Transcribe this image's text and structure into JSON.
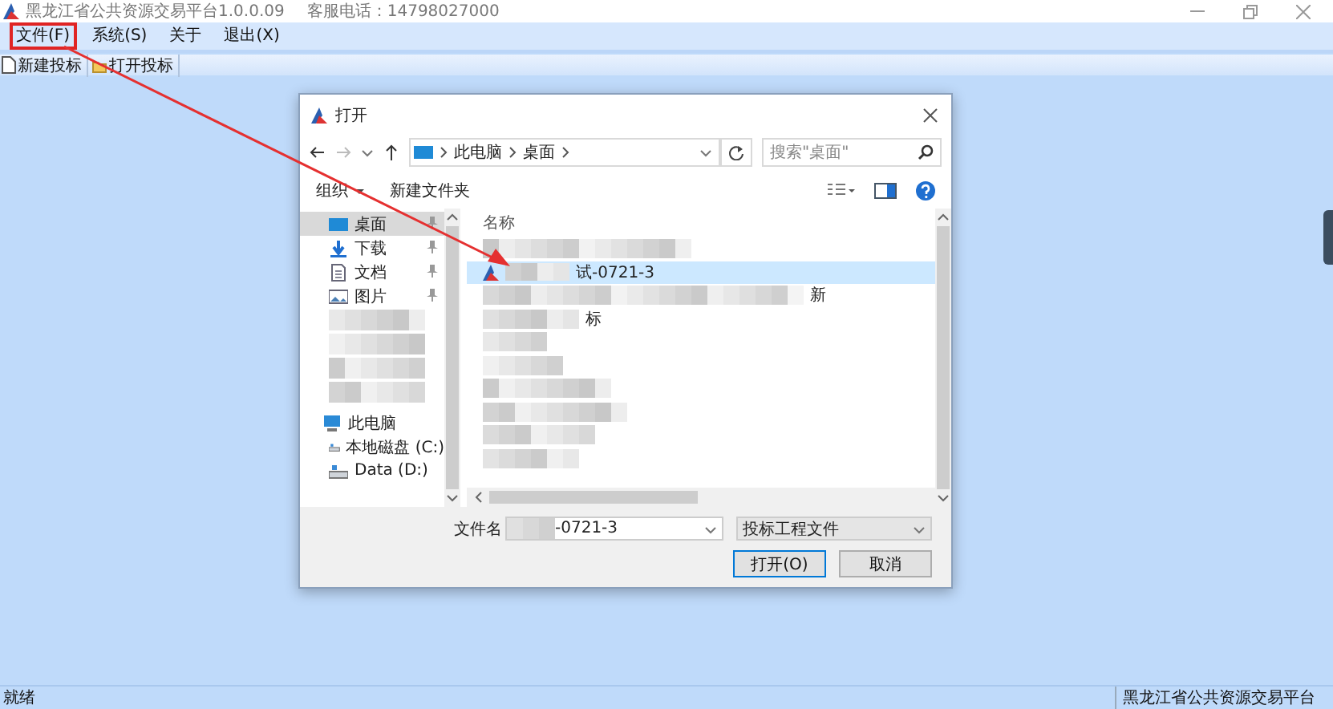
{
  "window": {
    "title": "黑龙江省公共资源交易平台1.0.0.09",
    "hotline": "客服电话：14798027000"
  },
  "menu": [
    {
      "label": "文件(F)",
      "marked": true
    },
    {
      "label": "系统(S)",
      "marked": false
    },
    {
      "label": "关于",
      "marked": false
    },
    {
      "label": "退出(X)",
      "marked": false
    }
  ],
  "toolbar": [
    {
      "label": "新建投标",
      "kind": "page"
    },
    {
      "label": "打开投标",
      "kind": "folder"
    }
  ],
  "dialog": {
    "title": "打开",
    "path": [
      "此电脑",
      "桌面"
    ],
    "search": {
      "placeholder": "搜索\"桌面\""
    },
    "commands": [
      {
        "label": "组织",
        "kind": "menu"
      },
      {
        "label": "新建文件夹",
        "kind": "plain"
      }
    ],
    "nav": [
      {
        "kind": "desktop",
        "label": "桌面",
        "selected": true,
        "pinned": true
      },
      {
        "kind": "download",
        "label": "下载",
        "selected": false,
        "pinned": true
      },
      {
        "kind": "doc",
        "label": "文档",
        "selected": false,
        "pinned": true
      },
      {
        "kind": "image",
        "label": "图片",
        "selected": false,
        "pinned": true
      },
      {
        "kind": "blurred",
        "selected": false,
        "pinned": false
      },
      {
        "kind": "blurred",
        "selected": false,
        "pinned": false
      },
      {
        "kind": "blurred",
        "selected": false,
        "pinned": false
      },
      {
        "kind": "blurred",
        "selected": false,
        "pinned": false
      },
      {
        "kind": "pc",
        "label": "此电脑",
        "selected": false,
        "pinned": false
      },
      {
        "kind": "drive",
        "label": "本地磁盘 (C:)",
        "selected": false,
        "pinned": false
      },
      {
        "kind": "drive",
        "label": "Data (D:)",
        "selected": false,
        "pinned": false
      }
    ],
    "column": "名称",
    "files": [
      {
        "kind": "blurred",
        "selected": false
      },
      {
        "kind": "file",
        "name": "试-0721-3",
        "selected": true
      },
      {
        "kind": "blurred",
        "suffix": "新",
        "selected": false
      },
      {
        "kind": "blurred",
        "suffix": "标",
        "selected": false
      },
      {
        "kind": "blurred",
        "selected": false
      },
      {
        "kind": "blurred",
        "selected": false
      },
      {
        "kind": "blurred",
        "selected": false
      },
      {
        "kind": "blurred",
        "selected": false
      },
      {
        "kind": "blurred",
        "selected": false
      },
      {
        "kind": "blurred",
        "selected": false
      }
    ],
    "filename": {
      "label": "文件名",
      "value": "-0721-3"
    },
    "filetype": "投标工程文件",
    "buttons": [
      {
        "label": "打开(O)",
        "kind": "primary"
      },
      {
        "label": "取消",
        "kind": "normal"
      }
    ]
  },
  "status_bar": {
    "left": "就绪",
    "right": "黑龙江省公共资源交易平台"
  }
}
